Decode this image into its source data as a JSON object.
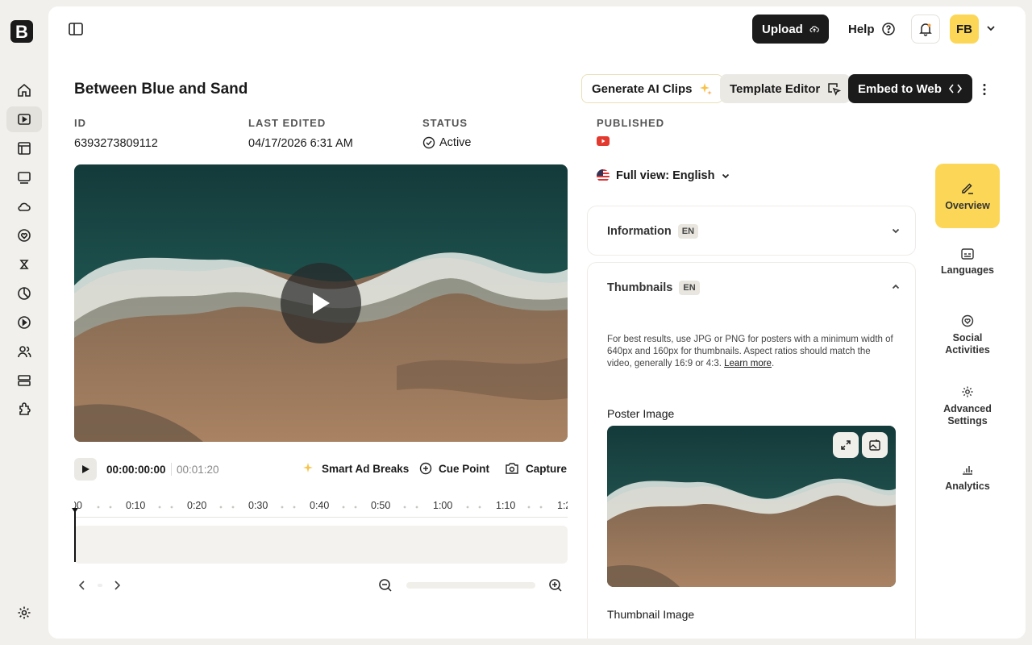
{
  "app": {
    "logo_letter": "B",
    "nav_items": [
      "home",
      "videos",
      "library",
      "playlists",
      "cloud",
      "social",
      "ai",
      "analytics",
      "live",
      "users",
      "storage",
      "integrations"
    ],
    "settings_icon": "gear-icon"
  },
  "header": {
    "upload_label": "Upload",
    "help_label": "Help",
    "avatar_initials": "FB"
  },
  "video": {
    "title": "Between Blue and Sand",
    "id_label": "ID",
    "id_value": "6393273809112",
    "last_edited_label": "LAST EDITED",
    "last_edited_value": "04/17/2026 6:31 AM",
    "status_label": "STATUS",
    "status_value": "Active",
    "published_label": "PUBLISHED"
  },
  "actions": {
    "generate_label": "Generate AI Clips",
    "template_label": "Template Editor",
    "embed_label": "Embed to Web"
  },
  "player": {
    "current_time": "00:00:00:00",
    "duration": "00:01:20",
    "smart_ad_label": "Smart Ad Breaks",
    "cue_point_label": "Cue Point",
    "capture_label": "Capture",
    "ticks": [
      "00",
      "0:10",
      "0:20",
      "0:30",
      "0:40",
      "0:50",
      "1:00",
      "1:10",
      "1:2"
    ]
  },
  "right": {
    "view_label": "Full view: English",
    "information_label": "Information",
    "information_badge": "EN",
    "thumbnails_label": "Thumbnails",
    "thumbnails_badge": "EN",
    "help_text": "For best results, use JPG or PNG for posters with a minimum width of 640px and 160px for thumbnails. Aspect ratios should match the video, generally 16:9 or 4:3.",
    "learn_more": "Learn more",
    "poster_label": "Poster Image",
    "thumbnail_label": "Thumbnail Image"
  },
  "sidetabs": {
    "overview": "Overview",
    "languages": "Languages",
    "social_1": "Social",
    "social_2": "Activities",
    "advanced_1": "Advanced",
    "advanced_2": "Settings",
    "analytics": "Analytics"
  },
  "colors": {
    "accent": "#fcd757",
    "dark": "#1b1b1b",
    "sea": "#1f4f4a",
    "sand": "#8a6a4c"
  }
}
